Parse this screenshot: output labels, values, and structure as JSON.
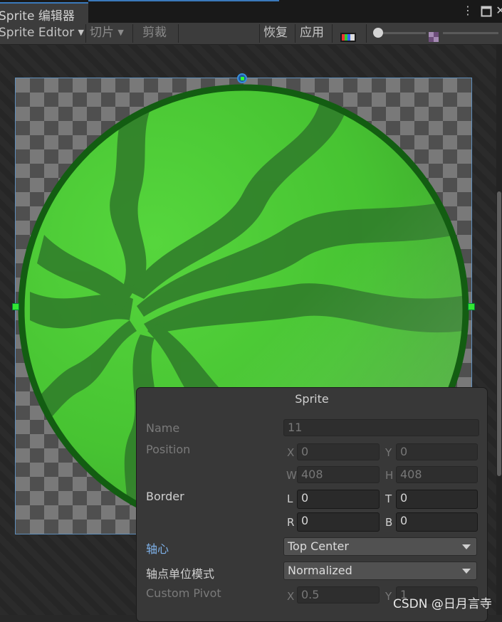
{
  "window": {
    "tab_title": "Sprite 编辑器"
  },
  "toolbar": {
    "mode_label": "Sprite Editor",
    "slice_label": "切片",
    "trim_label": "剪裁",
    "revert_label": "恢复",
    "apply_label": "应用"
  },
  "panel": {
    "title": "Sprite",
    "name_label": "Name",
    "name_value": "11",
    "position_label": "Position",
    "pos_x_label": "X",
    "pos_x": "0",
    "pos_y_label": "Y",
    "pos_y": "0",
    "pos_w_label": "W",
    "pos_w": "408",
    "pos_h_label": "H",
    "pos_h": "408",
    "border_label": "Border",
    "border_l_label": "L",
    "border_l": "0",
    "border_t_label": "T",
    "border_t": "0",
    "border_r_label": "R",
    "border_r": "0",
    "border_b_label": "B",
    "border_b": "0",
    "pivot_label": "轴心",
    "pivot_value": "Top Center",
    "pivot_unit_label": "轴点单位模式",
    "pivot_unit_value": "Normalized",
    "custom_pivot_label": "Custom Pivot",
    "cp_x_label": "X",
    "cp_x": "0.5",
    "cp_y_label": "Y",
    "cp_y": "1"
  },
  "watermark": "CSDN @日月言寺",
  "colors": {
    "accent": "#3a79bb",
    "link": "#7fb2ea",
    "handle": "#33e633"
  }
}
